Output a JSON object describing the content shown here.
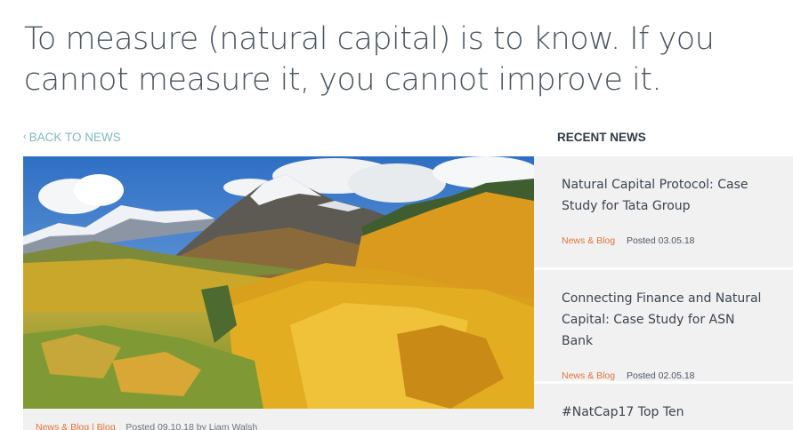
{
  "article": {
    "title": "To measure (natural capital) is to know. If you cannot measure it, you cannot improve it.",
    "back_link": "BACK TO NEWS",
    "hero_image_alt": "Autumn aspen forest below snowy mountains",
    "meta": {
      "categories": "News & Blog | Blog",
      "posted": "Posted 09.10.18 by Liam Walsh"
    }
  },
  "sidebar": {
    "heading": "RECENT NEWS",
    "items": [
      {
        "title": "Natural Capital Protocol: Case Study for Tata Group",
        "category": "News & Blog",
        "posted": "Posted 03.05.18"
      },
      {
        "title": "Connecting Finance and Natural Capital: Case Study for ASN Bank",
        "category": "News & Blog",
        "posted": "Posted 02.05.18"
      },
      {
        "title": "#NatCap17 Top Ten"
      }
    ]
  },
  "colors": {
    "accent_link": "#82b7bd",
    "category_orange": "#e0743a",
    "panel_gray": "#f1f1f1"
  }
}
